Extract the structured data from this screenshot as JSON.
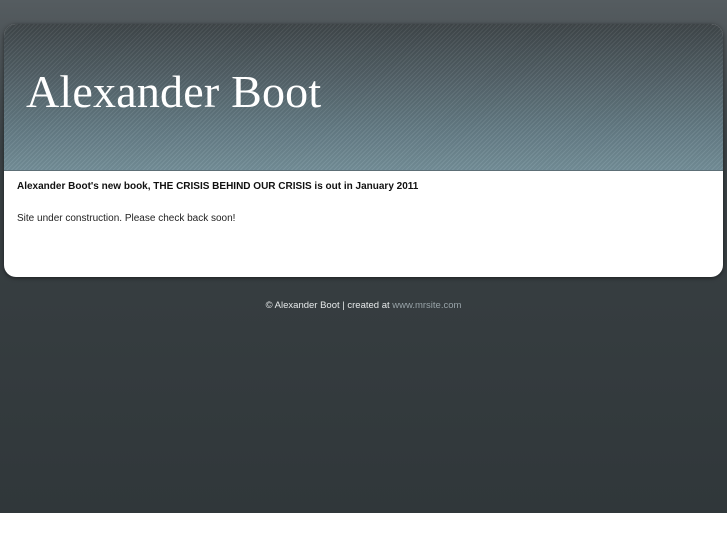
{
  "header": {
    "site_title": "Alexander Boot"
  },
  "main": {
    "headline": "Alexander Boot's new book, THE CRISIS BEHIND OUR CRISIS is out in January 2011",
    "notice": "Site under construction. Please check back soon!"
  },
  "footer": {
    "copyright": "© Alexander Boot | created at",
    "link_text": "www.mrsite.com"
  }
}
